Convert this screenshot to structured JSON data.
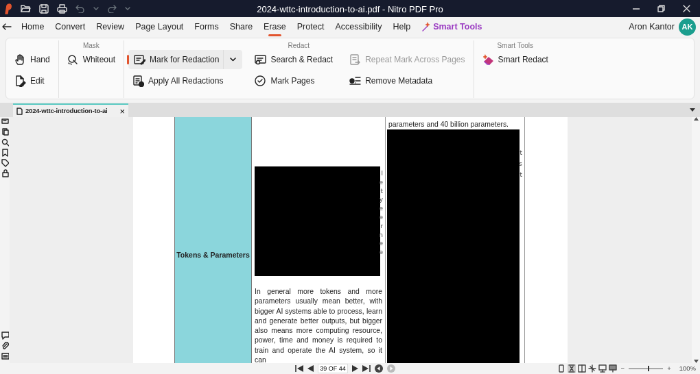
{
  "window": {
    "title": "2024-wttc-introduction-to-ai.pdf - Nitro PDF Pro"
  },
  "menu": [
    {
      "label": "Home",
      "selected": false,
      "kind": "tab"
    },
    {
      "label": "Convert",
      "selected": false,
      "kind": "tab"
    },
    {
      "label": "Review",
      "selected": false,
      "kind": "tab"
    },
    {
      "label": "Page Layout",
      "selected": false,
      "kind": "tab"
    },
    {
      "label": "Forms",
      "selected": false,
      "kind": "tab"
    },
    {
      "label": "Share",
      "selected": false,
      "kind": "tab"
    },
    {
      "label": "Erase",
      "selected": true,
      "kind": "tab"
    },
    {
      "label": "Protect",
      "selected": false,
      "kind": "tab"
    },
    {
      "label": "Accessibility",
      "selected": false,
      "kind": "tab"
    },
    {
      "label": "Help",
      "selected": false,
      "kind": "tab"
    },
    {
      "label": "Smart Tools",
      "selected": false,
      "kind": "smart"
    }
  ],
  "user": {
    "name": "Aron Kantor",
    "initials": "AK"
  },
  "ribbon": [
    {
      "columns": [
        [
          {
            "label": "Hand",
            "selected": false,
            "disabled": false
          },
          {
            "label": "Edit",
            "selected": false,
            "disabled": false
          }
        ]
      ]
    },
    {
      "label": "Mask",
      "columns": [
        [
          {
            "label": "Whiteout",
            "selected": false,
            "disabled": false
          }
        ]
      ]
    },
    {
      "label": "Redact",
      "columns": [
        [
          {
            "label": "Mark for Redaction",
            "selected": true,
            "disabled": false,
            "dropdown": true
          },
          {
            "label": "Apply All Redactions",
            "selected": false,
            "disabled": false
          }
        ],
        [
          {
            "label": "Search & Redact",
            "selected": false,
            "disabled": false
          },
          {
            "label": "Mark Pages",
            "selected": false,
            "disabled": false
          }
        ],
        [
          {
            "label": "Repeat Mark Across Pages",
            "selected": false,
            "disabled": true
          },
          {
            "label": "Remove Metadata",
            "selected": false,
            "disabled": false
          }
        ]
      ]
    },
    {
      "label": "Smart Tools",
      "columns": [
        [
          {
            "label": "Smart Redact",
            "selected": false,
            "disabled": false
          }
        ]
      ]
    }
  ],
  "document_tab": {
    "label": "2024-wttc-introduction-to-ai",
    "close": "×"
  },
  "page": {
    "row_heading": "Tokens & Parameters",
    "middle_fragments": [
      "l",
      "e",
      "t",
      "y",
      "e",
      "e",
      "r",
      "n",
      "e",
      "e"
    ],
    "middle_text": "In general more tokens and more parameters usually mean better, with bigger AI systems able to process, learn and generate better outputs, but bigger also means more computing resource, power, time and money is required to train and operate the AI system, so it can",
    "right_text": "parameters and 40 billion parameters.",
    "right_fragments": [
      "t",
      "s",
      "t"
    ]
  },
  "status_bar": {
    "page": "39 OF 44",
    "level": 0.55,
    "zoom": "100%",
    "zoom_minus": "−",
    "zoom_plus": "+"
  }
}
